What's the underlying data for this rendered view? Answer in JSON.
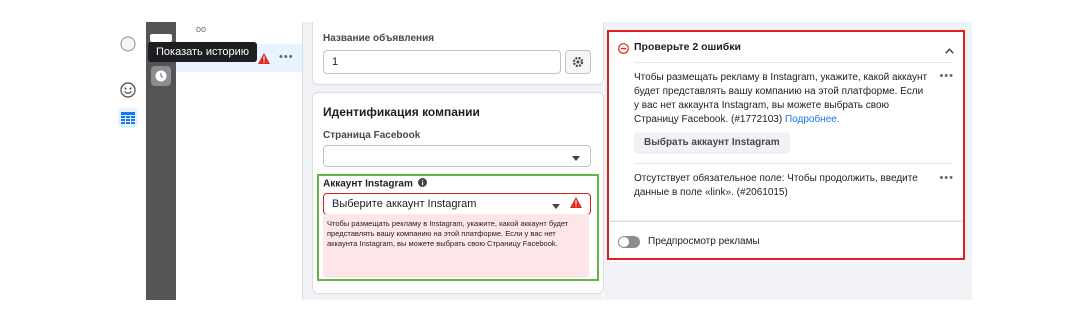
{
  "tooltip": {
    "text": "Показать историю"
  },
  "ad_name": {
    "label": "Название объявления",
    "value": "1"
  },
  "identity": {
    "heading": "Идентификация компании",
    "facebook_page_label": "Страница Facebook",
    "facebook_page_value": "",
    "instagram_label": "Аккаунт Instagram",
    "instagram_select_value": "Выберите аккаунт Instagram",
    "instagram_error": "Чтобы размещать рекламу в Instagram, укажите, какой аккаунт будет представлять вашу компанию на этой платформе. Если у вас нет аккаунта Instagram, вы можете выбрать свою Страницу Facebook."
  },
  "errors_panel": {
    "title": "Проверьте 2 ошибки",
    "error1_text": "Чтобы размещать рекламу в Instagram, укажите, какой аккаунт будет представлять вашу компанию на этой платформе. Если у вас нет аккаунта Instagram, вы можете выбрать свою Страницу Facebook. (#1772103)",
    "error1_link": "Подробнее.",
    "error1_button": "Выбрать аккаунт Instagram",
    "error2_text": "Отсутствует обязательное поле: Чтобы продолжить, введите данные в поле «link». (#2061015)"
  },
  "preview": {
    "label": "Предпросмотр рекламы"
  },
  "colors": {
    "accent": "#1877f2",
    "error": "#fa383e",
    "highlight_green": "#5fb548",
    "highlight_red": "#e0201a"
  },
  "icons": [
    "circle-icon",
    "smile-icon",
    "table-icon",
    "clock-icon",
    "warning-icon",
    "gear-icon",
    "info-icon",
    "minus-circle-icon",
    "chevron-up-icon",
    "chevron-down-icon",
    "more-icon"
  ]
}
